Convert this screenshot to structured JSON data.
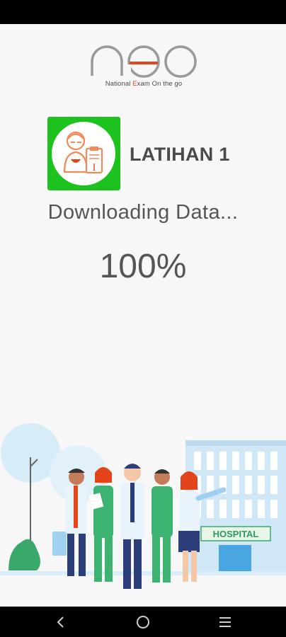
{
  "app": {
    "logo_text": "neo",
    "tagline_prefix": "National ",
    "tagline_highlight": "E",
    "tagline_suffix": "xam On the go"
  },
  "exam": {
    "title": "LATIHAN 1",
    "icon_letter": "I"
  },
  "download": {
    "status": "Downloading Data...",
    "progress_label": "100%",
    "progress": 1.0
  },
  "illustration": {
    "building_sign": "HOSPITAL"
  },
  "colors": {
    "brand_green": "#1ec21e",
    "brand_orange": "#e3441a",
    "text_gray": "#555555",
    "background": "#f7f7f7"
  },
  "nav": {
    "back_icon": "back-chevron-icon",
    "home_icon": "home-circle-icon",
    "recents_icon": "recents-lines-icon"
  }
}
